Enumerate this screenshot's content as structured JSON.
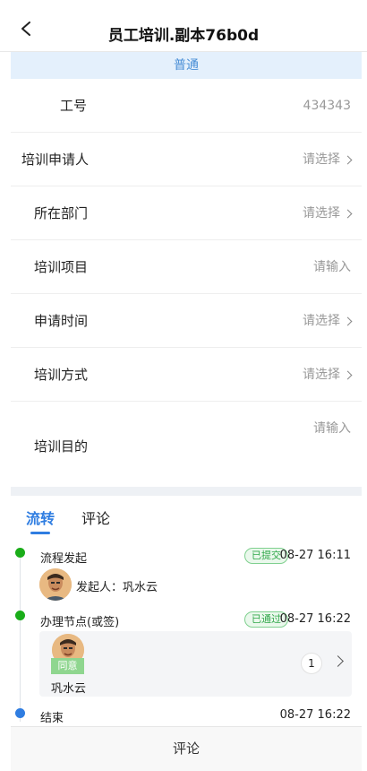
{
  "header": {
    "title": "员工培训.副本76b0d",
    "back_icon": "back-chevron-icon"
  },
  "level": {
    "text": "普通"
  },
  "form": {
    "employee_no": {
      "label": "工号",
      "value": "434343"
    },
    "applicant": {
      "label": "培训申请人",
      "placeholder": "请选择"
    },
    "department": {
      "label": "所在部门",
      "placeholder": "请选择"
    },
    "project": {
      "label": "培训项目",
      "placeholder": "请输入"
    },
    "apply_time": {
      "label": "申请时间",
      "placeholder": "请选择"
    },
    "method": {
      "label": "培训方式",
      "placeholder": "请选择"
    },
    "purpose": {
      "label": "培训目的",
      "placeholder": "请输入"
    }
  },
  "tabs": {
    "flow": "流转",
    "comment": "评论",
    "active": "flow"
  },
  "timeline": {
    "start": {
      "title": "流程发起",
      "status": "已提交",
      "time": "08-27 16:11",
      "initiator": "发起人：巩水云"
    },
    "node": {
      "title": "办理节点(或签)",
      "status": "已通过",
      "time": "08-27 16:22",
      "action": "同意",
      "approver": "巩水云",
      "count": "1"
    },
    "end": {
      "title": "结束",
      "time": "08-27 16:22"
    }
  },
  "footer": {
    "comment_label": "评论"
  },
  "colors": {
    "accent": "#2f7de1",
    "success": "#1aad19",
    "level_bg": "#e4f0fc"
  }
}
